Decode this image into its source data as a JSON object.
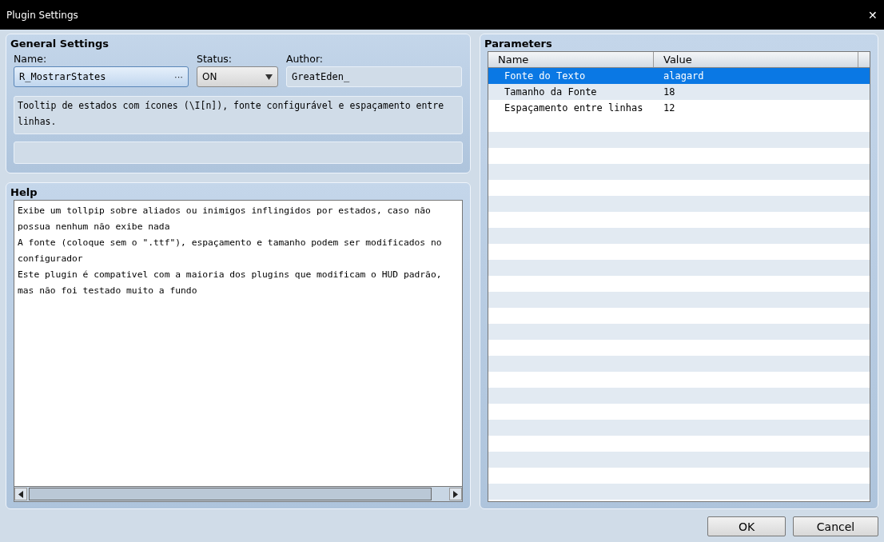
{
  "window": {
    "title": "Plugin Settings",
    "close": "✕"
  },
  "general": {
    "title": "General Settings",
    "name_label": "Name:",
    "name_value": "R_MostrarStates",
    "name_button": "···",
    "status_label": "Status:",
    "status_value": "ON",
    "author_label": "Author:",
    "author_value": "GreatEden_",
    "description": "Tooltip de estados com ícones (\\I[n]), fonte configurável e espaçamento entre linhas."
  },
  "help": {
    "title": "Help",
    "lines": [
      "Exibe um tollpip sobre aliados ou inimigos inflingidos por estados, caso não",
      "possua nenhum não exibe nada",
      "A fonte (coloque sem o \".ttf\"), espaçamento e tamanho podem ser modificados no",
      "configurador",
      "Este plugin é compativel com a maioria dos plugins que modificam o HUD padrão,",
      "mas não foi testado muito a fundo"
    ]
  },
  "parameters": {
    "title": "Parameters",
    "columns": [
      "Name",
      "Value"
    ],
    "rows": [
      {
        "name": "Fonte do Texto",
        "value": "alagard",
        "selected": true
      },
      {
        "name": "Tamanho da Fonte",
        "value": "18",
        "selected": false
      },
      {
        "name": "Espaçamento entre linhas",
        "value": "12",
        "selected": false
      }
    ]
  },
  "buttons": [
    "OK",
    "Cancel"
  ]
}
